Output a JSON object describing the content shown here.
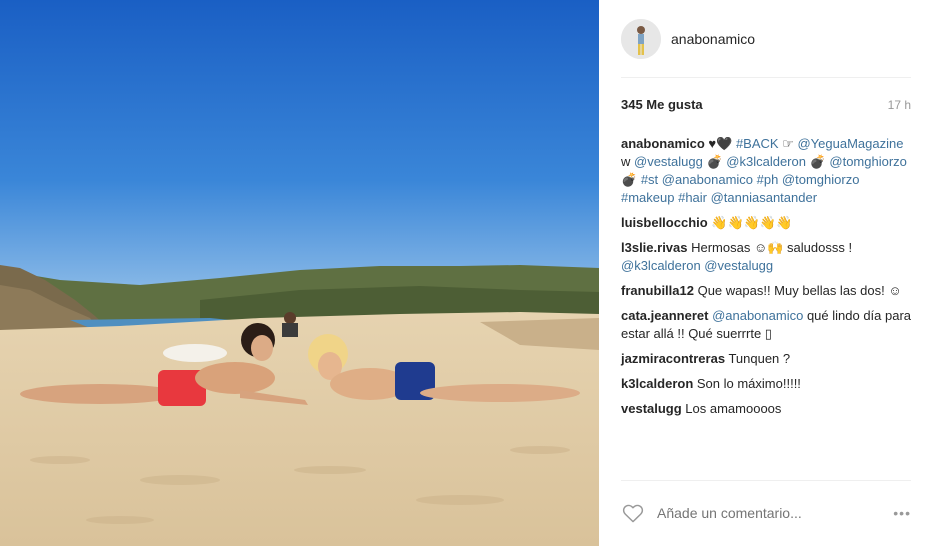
{
  "post": {
    "username": "anabonamico",
    "likes": "345 Me gusta",
    "time": "17 h"
  },
  "caption": {
    "user": "anabonamico",
    "parts": [
      {
        "t": "emo",
        "v": " ♥🖤 "
      },
      {
        "t": "link",
        "v": "#BACK"
      },
      {
        "t": "text",
        "v": " ☞ "
      },
      {
        "t": "link",
        "v": "@YeguaMagazine"
      },
      {
        "t": "text",
        "v": " w "
      },
      {
        "t": "link",
        "v": "@vestalugg"
      },
      {
        "t": "emo",
        "v": " 💣 "
      },
      {
        "t": "link",
        "v": "@k3lcalderon"
      },
      {
        "t": "emo",
        "v": " 💣 "
      },
      {
        "t": "link",
        "v": "@tomghiorzo"
      },
      {
        "t": "emo",
        "v": " 💣 "
      },
      {
        "t": "link",
        "v": "#st @anabonamico #ph @tomghiorzo #makeup #hair @tanniasantander"
      }
    ]
  },
  "comments": [
    {
      "user": "luisbellocchio",
      "text": " 👋👋👋👋👋",
      "link": ""
    },
    {
      "user": "l3slie.rivas",
      "text": " Hermosas ☺🙌 saludosss ! ",
      "link": "@k3lcalderon @vestalugg"
    },
    {
      "user": "franubilla12",
      "text": " Que wapas!! Muy bellas las dos! ☺",
      "link": ""
    },
    {
      "user": "cata.jeanneret",
      "text": " qué lindo día para estar allá !! Qué suerrrte ▯",
      "link": "@anabonamico",
      "link_first": true
    },
    {
      "user": "jazmiracontreras",
      "text": " Tunquen ?",
      "link": ""
    },
    {
      "user": "k3lcalderon",
      "text": " Son lo máximo!!!!!",
      "link": ""
    },
    {
      "user": "vestalugg",
      "text": " Los amamoooos",
      "link": ""
    }
  ],
  "footer": {
    "placeholder": "Añade un comentario...",
    "more": "•••"
  },
  "icons": {
    "like": "heart-outline-icon",
    "more": "more-options-icon"
  },
  "colors": {
    "link": "#3f729b",
    "muted": "#999999"
  }
}
